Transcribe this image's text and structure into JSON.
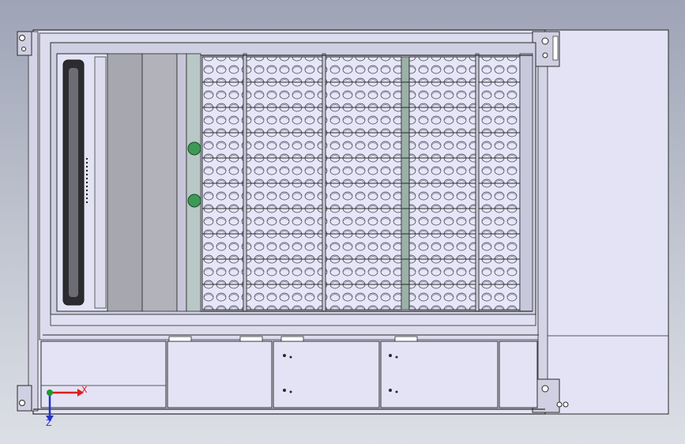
{
  "app": {
    "view": "cad-model-viewport",
    "model": "rack-enclosure-top-view"
  },
  "axes": {
    "x_label": "X",
    "z_label": "Z"
  },
  "colors": {
    "background_top": "#9ea4b6",
    "background_bottom": "#dcdfe6",
    "part_fill": "#e3e3f5",
    "line": "#2a2a2a",
    "gray_panel": "#a7a7b0",
    "fan_green": "#3d9a55",
    "axis_x": "#d92020",
    "axis_y": "#1f9a2a",
    "axis_z": "#2233cc"
  },
  "icons": {
    "triad": "coordinate-triad-icon"
  }
}
